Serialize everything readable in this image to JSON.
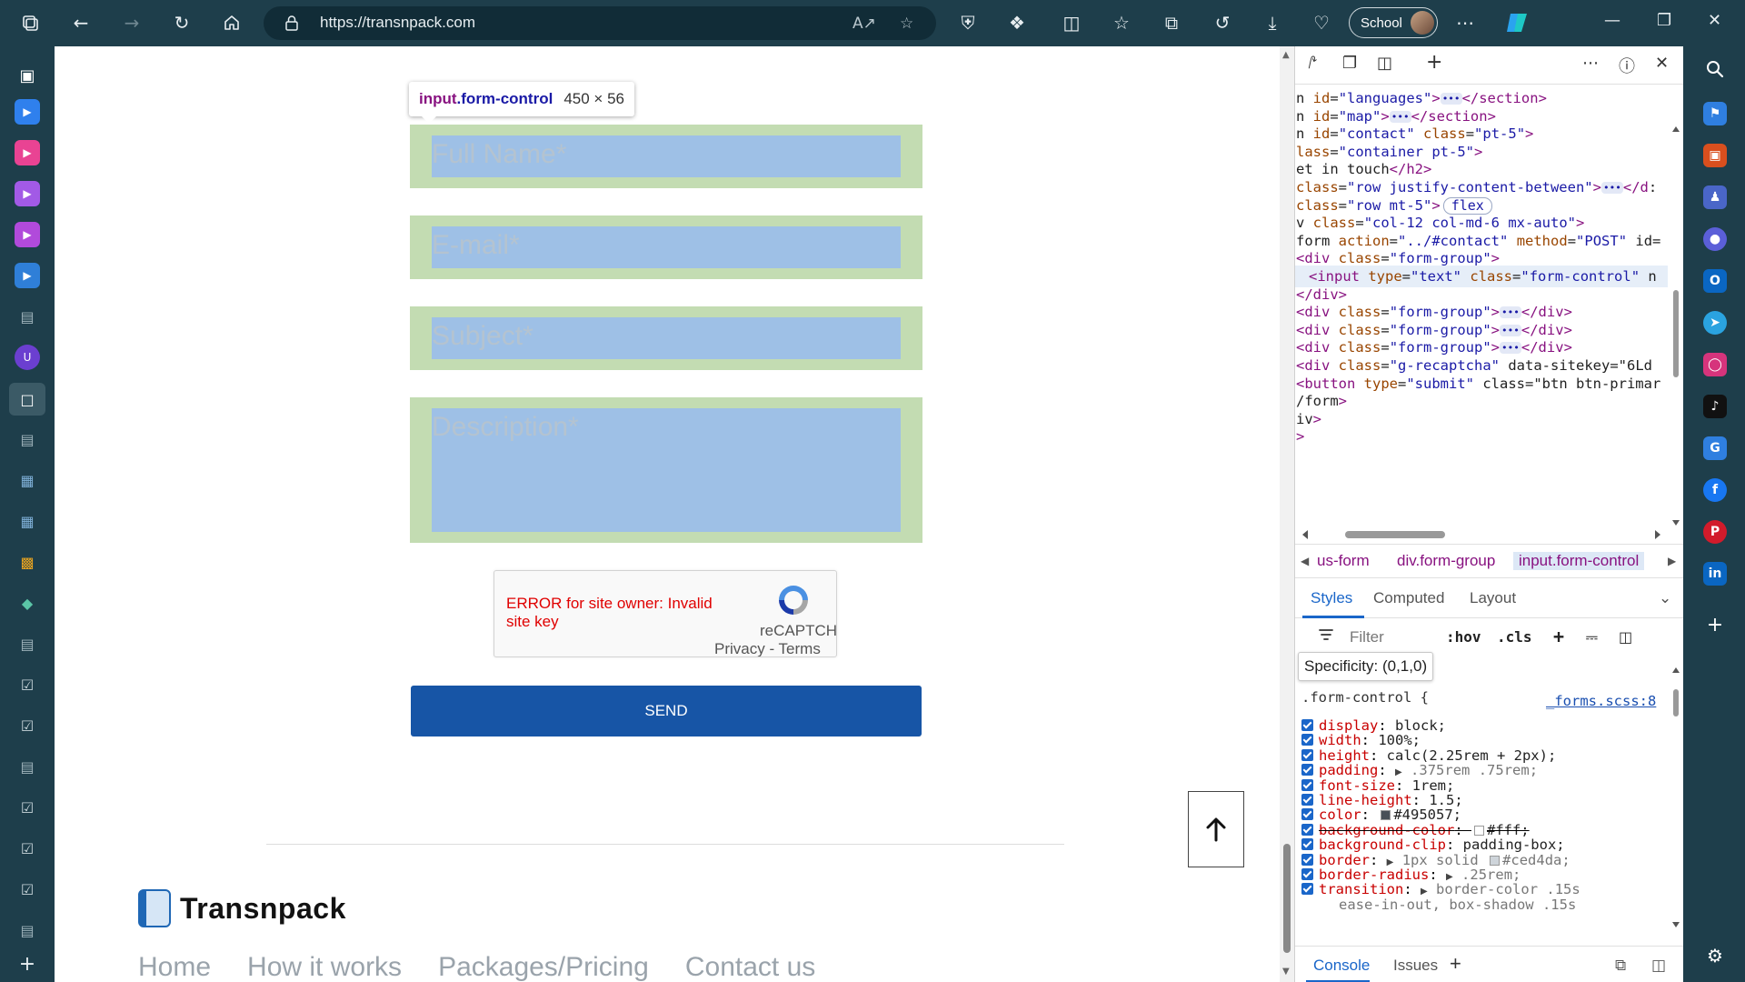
{
  "browser": {
    "url": "https://transnpack.com",
    "profile_label": "School"
  },
  "tooltip": {
    "selector_tag": "input",
    "selector_class": ".form-control",
    "size": "450 × 56"
  },
  "form": {
    "fields": [
      {
        "placeholder": "Full Name*"
      },
      {
        "placeholder": "E-mail*"
      },
      {
        "placeholder": "Subject*"
      },
      {
        "placeholder": "Description*"
      }
    ],
    "captcha_error": "ERROR for site owner: Invalid site key",
    "captcha_brand": "reCAPTCHA",
    "captcha_privacy": "Privacy",
    "captcha_sep": " - ",
    "captcha_terms": "Terms",
    "send_label": "SEND"
  },
  "footer": {
    "brand": "Transnpack",
    "nav": [
      "Home",
      "How it works",
      "Packages/Pricing",
      "Contact us"
    ]
  },
  "devtools": {
    "dom_lines": [
      {
        "t": "n id=\"languages\">",
        "e": true,
        "c": "</section>"
      },
      {
        "t": "n id=\"map\">",
        "e": true,
        "c": "</section>"
      },
      {
        "t": "n id=\"contact\" class=\"pt-5\">"
      },
      {
        "t": "lass=\"container pt-5\">"
      },
      {
        "t": "et in touch</h2>"
      },
      {
        "t": " class=\"row justify-content-between\">",
        "e": true,
        "c": "</d:"
      },
      {
        "t": " class=\"row mt-5\">",
        "badge": "flex"
      },
      {
        "t": "v class=\"col-12 col-md-6 mx-auto\">"
      },
      {
        "t": "form action=\"../#contact\" method=\"POST\" id="
      },
      {
        "t": "<div class=\"form-group\">"
      },
      {
        "t": "<input type=\"text\" class=\"form-control\" n",
        "sel": true
      },
      {
        "t": "</div>"
      },
      {
        "t": "<div class=\"form-group\">",
        "e": true,
        "c": "</div>"
      },
      {
        "t": "<div class=\"form-group\">",
        "e": true,
        "c": "</div>"
      },
      {
        "t": "<div class=\"form-group\">",
        "e": true,
        "c": "</div>"
      },
      {
        "t": "<div class=\"g-recaptcha\" data-sitekey=\"6Ld"
      },
      {
        "t": "<button type=\"submit\" class=\"btn btn-primar"
      },
      {
        "t": "/form>"
      },
      {
        "t": "iv>"
      },
      {
        "t": ">"
      }
    ],
    "breadcrumbs": [
      "us-form",
      "div.form-group",
      "input.form-control"
    ],
    "style_tabs": [
      "Styles",
      "Computed",
      "Layout"
    ],
    "filter_placeholder": "Filter",
    "hov_label": ":hov",
    "cls_label": ".cls",
    "specificity": "Specificity: (0,1,0)",
    "rule_selector": ".form-control {",
    "rule_source": "_forms.scss:8",
    "declarations": [
      {
        "name": "display",
        "value": "block;"
      },
      {
        "name": "width",
        "value": "100%;"
      },
      {
        "name": "height",
        "value": "calc(2.25rem + 2px);"
      },
      {
        "name": "padding",
        "value": ".375rem .75rem;",
        "expand": true
      },
      {
        "name": "font-size",
        "value": "1rem;"
      },
      {
        "name": "line-height",
        "value": "1.5;"
      },
      {
        "name": "color",
        "value": "#495057;",
        "swatch": "#495057"
      },
      {
        "name": "background-color",
        "value": "#fff;",
        "swatch": "#ffffff",
        "struck": true
      },
      {
        "name": "background-clip",
        "value": "padding-box;"
      },
      {
        "name": "border",
        "value": "1px solid #ced4da;",
        "expand": true,
        "swatch_mid": "#ced4da"
      },
      {
        "name": "border-radius",
        "value": ".25rem;",
        "expand": true
      },
      {
        "name": "transition",
        "value": "border-color .15s",
        "expand": true
      }
    ],
    "transition_cont": "ease-in-out, box-shadow .15s",
    "drawer_tabs": [
      "Console",
      "Issues"
    ]
  },
  "colors": {
    "accent": "#1755a6",
    "field_margin": "#c3dcb2",
    "field_content": "#9ec0e6",
    "chrome": "#1e3e4b"
  }
}
